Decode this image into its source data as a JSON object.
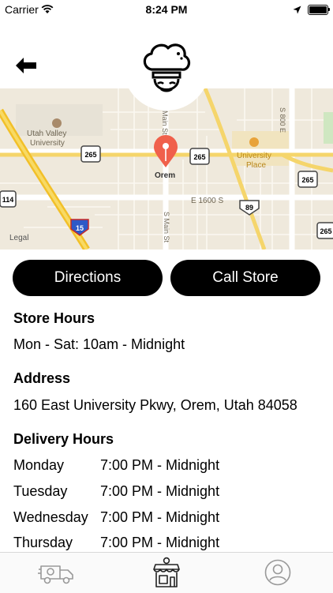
{
  "status": {
    "carrier": "Carrier",
    "time": "8:24 PM"
  },
  "header": {
    "back_icon": "arrow-left-icon",
    "logo_icon": "chef-logo-icon"
  },
  "map": {
    "labels": {
      "uvu": "Utah Valley",
      "uvu2": "University",
      "orem": "Orem",
      "univ_place": "University",
      "univ_place2": "Place",
      "main_st_n": "Main St",
      "main_st_s": "S Main St",
      "e1600": "E 1600 S",
      "s800": "S 800 E",
      "legal": "Legal",
      "shield_265a": "265",
      "shield_265b": "265",
      "shield_265c": "265",
      "shield_265d": "265",
      "shield_114": "114",
      "shield_89": "89",
      "shield_15": "15"
    }
  },
  "actions": {
    "directions": "Directions",
    "call": "Call Store"
  },
  "store_hours": {
    "title": "Store Hours",
    "text": "Mon - Sat: 10am - Midnight"
  },
  "address": {
    "title": "Address",
    "text": "160 East University Pkwy, Orem, Utah 84058"
  },
  "delivery": {
    "title": "Delivery Hours",
    "rows": [
      {
        "day": "Monday",
        "hours": "7:00 PM - Midnight"
      },
      {
        "day": "Tuesday",
        "hours": "7:00 PM - Midnight"
      },
      {
        "day": "Wednesday",
        "hours": "7:00 PM - Midnight"
      },
      {
        "day": "Thursday",
        "hours": "7:00 PM - Midnight"
      }
    ]
  },
  "tabs": [
    {
      "icon": "delivery-truck-icon",
      "active": false
    },
    {
      "icon": "store-icon",
      "active": true
    },
    {
      "icon": "profile-icon",
      "active": false
    }
  ]
}
